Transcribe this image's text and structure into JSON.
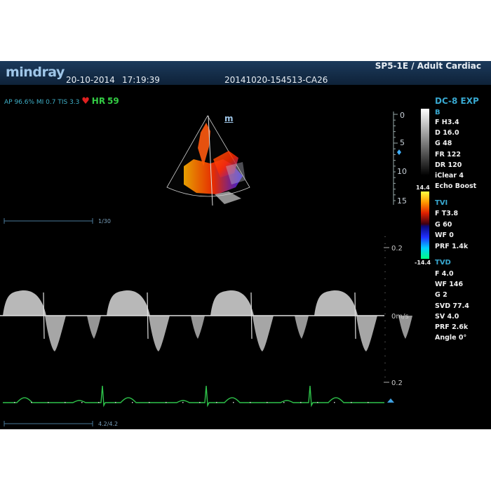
{
  "header": {
    "brand": "mindray",
    "date": "20-10-2014",
    "time": "17:19:39",
    "study_id": "20141020-154513-CA26",
    "probe_preset": "SP5-1E / Adult Cardiac"
  },
  "status": {
    "acoustic": "AP 96.6%  MI 0.7  TIS 3.3",
    "hr_label": "HR",
    "hr_value": "59",
    "heart_icon": "heart-icon"
  },
  "image_marker": "m",
  "depth_scale": [
    "0",
    "5",
    "10",
    "15"
  ],
  "mode_title": "DC-8 EXP",
  "b_mode": {
    "title": "B",
    "params": [
      "F H3.4",
      "D 16.0",
      "G 48",
      "FR 122",
      "DR 120",
      "iClear 4",
      "Echo Boost"
    ]
  },
  "tvi": {
    "title": "TVI",
    "scale_max": "14.4",
    "scale_min": "-14.4",
    "params": [
      "F T3.8",
      "G 60",
      "WF 0",
      "PRF 1.4k"
    ]
  },
  "tvd": {
    "title": "TVD",
    "params": [
      "F 4.0",
      "WF 146",
      "G 2",
      "SVD 77.4",
      "SV 4.0",
      "PRF 2.6k",
      "Angle 0°"
    ]
  },
  "doppler": {
    "scale_top": "0.2",
    "baseline_label": "0m/s",
    "scale_bottom": "0.2"
  },
  "cine_top": "1/30",
  "cine_bottom": "4.2/4.2",
  "colors": {
    "screen_bg": "#000000",
    "header_bg": "#1c3a5c",
    "accent": "#38a8d0",
    "ecg": "#2ec24a",
    "heart": "#e02020"
  }
}
